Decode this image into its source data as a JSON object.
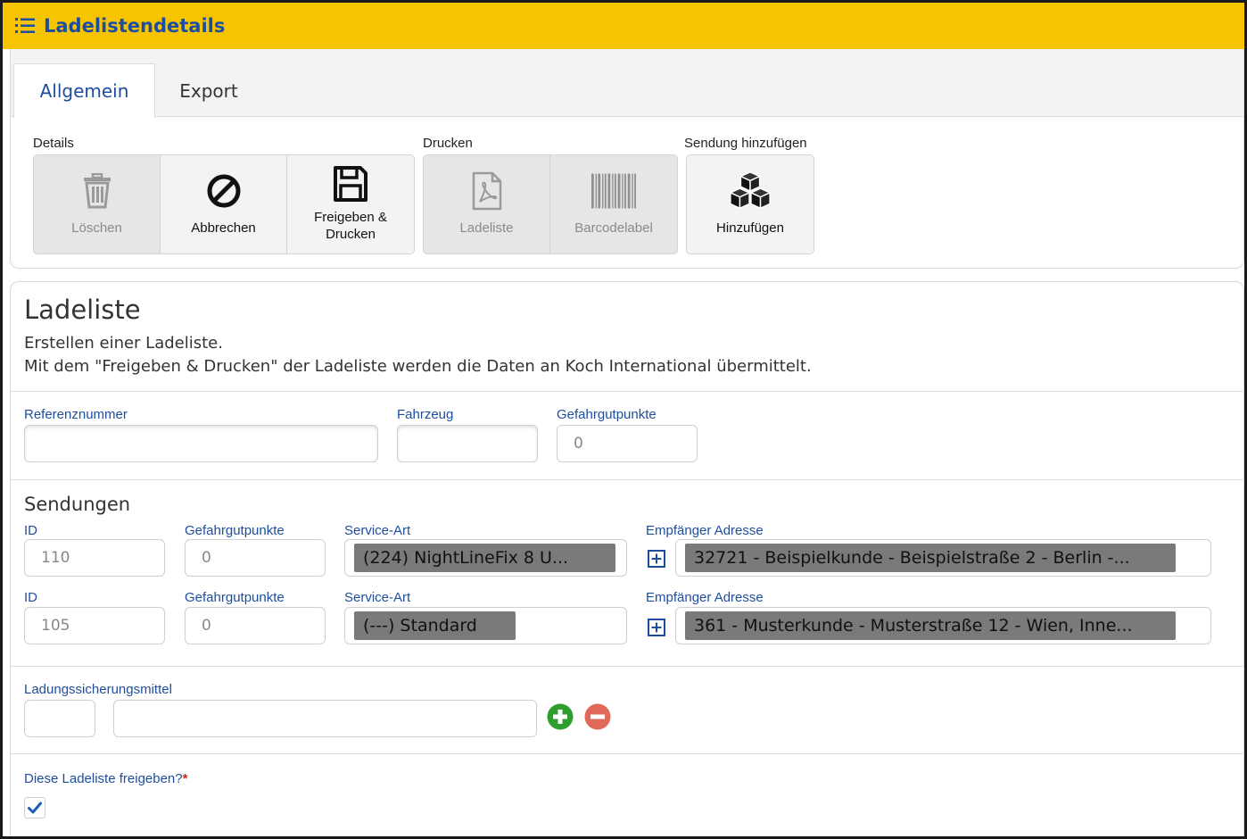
{
  "header": {
    "title": "Ladelistendetails",
    "icon": "list-numbered-icon"
  },
  "tabs": [
    {
      "label": "Allgemein",
      "active": true
    },
    {
      "label": "Export",
      "active": false
    }
  ],
  "toolbar": {
    "groups": [
      {
        "label": "Details",
        "buttons": [
          {
            "label": "Löschen",
            "icon": "trash-icon",
            "enabled": false
          },
          {
            "label": "Abbrechen",
            "icon": "cancel-icon",
            "enabled": true
          },
          {
            "label": "Freigeben & Drucken",
            "icon": "floppy-disk-icon",
            "enabled": true
          }
        ]
      },
      {
        "label": "Drucken",
        "buttons": [
          {
            "label": "Ladeliste",
            "icon": "pdf-file-icon",
            "enabled": false
          },
          {
            "label": "Barcodelabel",
            "icon": "barcode-icon",
            "enabled": false
          }
        ]
      },
      {
        "label": "Sendung hinzufügen",
        "buttons": [
          {
            "label": "Hinzufügen",
            "icon": "boxes-icon",
            "enabled": true
          }
        ]
      }
    ]
  },
  "main": {
    "title": "Ladeliste",
    "description_line1": "Erstellen einer Ladeliste.",
    "description_line2": "Mit dem \"Freigeben & Drucken\" der Ladeliste werden die Daten an Koch International übermittelt.",
    "fields": {
      "referenznummer": {
        "label": "Referenznummer",
        "value": ""
      },
      "fahrzeug": {
        "label": "Fahrzeug",
        "value": ""
      },
      "gefahrgutpunkte": {
        "label": "Gefahrgutpunkte",
        "value": "0"
      }
    },
    "sendungen": {
      "title": "Sendungen",
      "labels": {
        "id": "ID",
        "gefahrgut": "Gefahrgutpunkte",
        "service": "Service-Art",
        "empfaenger": "Empfänger Adresse"
      },
      "rows": [
        {
          "id": "110",
          "gefahrgut": "0",
          "service": "(224) NightLineFix 8 U...",
          "empfaenger": "32721 - Beispielkunde - Beispielstraße 2 - Berlin -..."
        },
        {
          "id": "105",
          "gefahrgut": "0",
          "service": "(---) Standard",
          "empfaenger": "361 - Musterkunde - Musterstraße 12 - Wien, Inne..."
        }
      ]
    },
    "ladungssicherung": {
      "label": "Ladungssicherungsmittel",
      "qty": "",
      "name": ""
    },
    "freigeben": {
      "label": "Diese Ladeliste freigeben?",
      "required_mark": "*",
      "checked": true
    }
  },
  "colors": {
    "header_bg": "#f6c400",
    "accent_blue": "#1d4e9e",
    "add_green": "#2e9e2e",
    "remove_red": "#e0695a",
    "pill_gray": "#7a7a7a"
  }
}
